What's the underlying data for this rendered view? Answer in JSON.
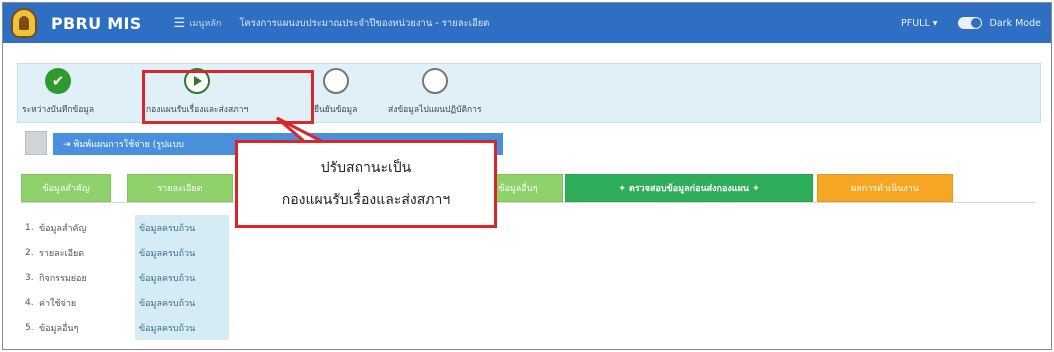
{
  "navbar": {
    "brand": "PBRU MIS",
    "menu_icon": "hamburger-icon",
    "menu_label": "เมนูหลัก",
    "page_title": "โครงการแผนงบประมาณประจำปีของหน่วยงาน - รายละเอียด",
    "user": "PFULL ▾",
    "dark_mode_label": "Dark Mode",
    "color": "#2f6fc3"
  },
  "stepper": {
    "steps": [
      {
        "label": "ระหว่างบันทึกข้อมูล",
        "state": "done"
      },
      {
        "label": "กองแผนรับเรื่องและส่งสภาฯ",
        "state": "current"
      },
      {
        "label": "ยืนยันข้อมูล",
        "state": "todo"
      },
      {
        "label": "ส่งข้อมูลไปแผนปฏิบัติการ",
        "state": "todo"
      }
    ]
  },
  "action_strip": {
    "button_label": "⇥ พิมพ์แผนการใช้จ่าย (รูปแบบ"
  },
  "tabs": [
    {
      "label": "ข้อมูลสำคัญ",
      "color": "#8fd16b"
    },
    {
      "label": "รายละเอียด",
      "color": "#8fd16b"
    },
    {
      "label": "ข้อมูลอื่นๆ",
      "color": "#8fd16b"
    },
    {
      "label": "✦ ตรวจสอบข้อมูลก่อนส่งกองแผน ✦",
      "color": "#2eae5a"
    },
    {
      "label": "ผลการดำเนินงาน",
      "color": "#f5a623"
    }
  ],
  "checklist": [
    {
      "num": "1.",
      "name": "ข้อมูลสำคัญ",
      "status": "ข้อมูลครบถ้วน"
    },
    {
      "num": "2.",
      "name": "รายละเอียด",
      "status": "ข้อมูลครบถ้วน"
    },
    {
      "num": "3.",
      "name": "กิจกรรมย่อย",
      "status": "ข้อมูลครบถ้วน"
    },
    {
      "num": "4.",
      "name": "ค่าใช้จ่าย",
      "status": "ข้อมูลครบถ้วน"
    },
    {
      "num": "5.",
      "name": "ข้อมูลอื่นๆ",
      "status": "ข้อมูลครบถ้วน"
    }
  ],
  "callout": {
    "line1": "ปรับสถานะเป็น",
    "line2": "กองแผนรับเรื่องและส่งสภาฯ",
    "border_color": "#d9262b"
  }
}
